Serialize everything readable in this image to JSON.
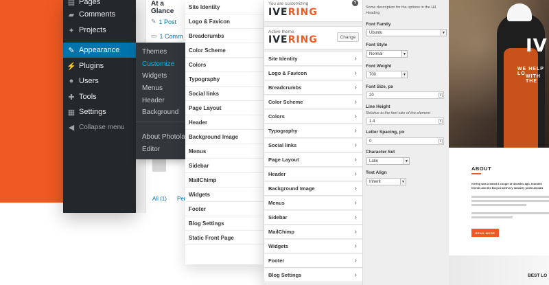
{
  "colors": {
    "brand": "#f05a22",
    "wp_dark": "#23282d",
    "wp_blue": "#0073aa",
    "wp_sub": "#32373c"
  },
  "wp_admin": {
    "items": [
      {
        "label": "Pages",
        "icon": "pages-icon"
      },
      {
        "label": "Comments",
        "icon": "comments-icon"
      },
      {
        "label": "Projects",
        "icon": "pin-icon"
      },
      {
        "label": "Appearance",
        "icon": "brush-icon",
        "active": true
      },
      {
        "label": "Plugins",
        "icon": "plug-icon"
      },
      {
        "label": "Users",
        "icon": "user-icon"
      },
      {
        "label": "Tools",
        "icon": "wrench-icon"
      },
      {
        "label": "Settings",
        "icon": "settings-icon"
      },
      {
        "label": "Collapse menu",
        "icon": "collapse-icon"
      }
    ],
    "submenu": [
      "Themes",
      "Customize",
      "Widgets",
      "Menus",
      "Header",
      "Background",
      "About Photolab",
      "Editor"
    ]
  },
  "dashboard": {
    "at_a_glance": "At a Glance",
    "post": "1 Post",
    "comment": "1 Comm",
    "filter_all": "All (1)",
    "filter_pending": "Pen"
  },
  "panel1": {
    "items": [
      "Site Identity",
      "Logo & Favicon",
      "Breadcrumbs",
      "Color Scheme",
      "Colors",
      "Typography",
      "Social links",
      "Page Layout",
      "Header",
      "Background Image",
      "Menus",
      "Sidebar",
      "MailChimp",
      "Widgets",
      "Footer",
      "Blog Settings",
      "Static Front Page"
    ]
  },
  "panel2": {
    "customizing_label": "You are customizing",
    "active_theme_label": "Active theme",
    "logo_a": "IVE",
    "logo_b": "RING",
    "change_button": "Change",
    "help_icon": "help-icon",
    "items": [
      "Site Identity",
      "Logo & Favicon",
      "Breadcrumbs",
      "Color Scheme",
      "Colors",
      "Typography",
      "Social links",
      "Page Layout",
      "Header",
      "Background Image",
      "Menus",
      "Sidebar",
      "MailChimp",
      "Widgets",
      "Footer",
      "Blog Settings"
    ]
  },
  "panel3": {
    "description": "Some description for the options in the H4 Heading",
    "font_family_label": "Font Family",
    "font_family_value": "Ubuntu",
    "font_style_label": "Font Style",
    "font_style_value": "Normal",
    "font_weight_label": "Font Weight",
    "font_weight_value": "700",
    "font_size_label": "Font Size, px",
    "font_size_value": "20",
    "line_height_label": "Line Height",
    "line_height_note": "Relative to the font-size of the element",
    "line_height_value": "1.4",
    "letter_spacing_label": "Letter Spacing, px",
    "letter_spacing_value": "0",
    "charset_label": "Character Set",
    "charset_value": "Latin",
    "text_align_label": "Text Align",
    "text_align_value": "Inherit"
  },
  "preview": {
    "hero_title": "IV",
    "hero_sub": "WE HELP LO",
    "hero_sub2": "WITH THE",
    "about_title": "ABOUT",
    "about_lead": "Ivering was created a couple of decades ago, founded",
    "about_lead2": "friends and the Bicycle Delivery Industry professionals",
    "read_more": "READ MORE",
    "best_title": "BEST LO"
  }
}
